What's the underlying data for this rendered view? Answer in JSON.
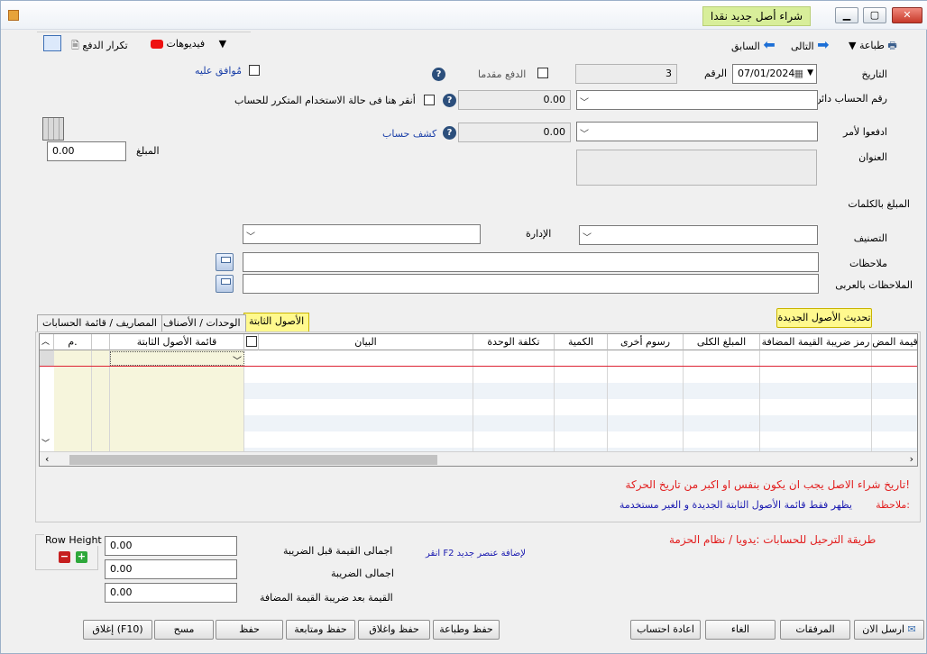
{
  "window": {
    "title": "شراء أصل جديد نقدا"
  },
  "toolbar": {
    "print": "طباعة",
    "next": "التالى",
    "previous": "السابق",
    "videos": "فيديوهات",
    "repeat_payment": "تكرار الدفع"
  },
  "header": {
    "date_label": "التاريخ",
    "date_value": "07/01/2024",
    "number_label": "الرقم",
    "number_value": "3",
    "prepaid_label": "الدفع مقدما",
    "approved_label": "مُوافق عليه",
    "credit_account_label": "رقم  الحساب دائن",
    "credit_amount": "0.00",
    "recurring_label": "أنقر هنا فى حالة الاستخدام المتكرر للحساب",
    "pay_to_label": "ادفعوا لأمر",
    "pay_to_amount": "0.00",
    "statement_link": "كشف حساب",
    "address_label": "العنوان",
    "amount_label": "المبلغ",
    "amount_value": "0.00",
    "amount_words_label": "المبلغ بالكلمات",
    "category_label": "التصنيف",
    "department_label": "الإدارة",
    "notes_label": "ملاحظات",
    "notes_ar_label": "الملاحظات بالعربى"
  },
  "update_assets_button": "تحديث الأصول الجديدة",
  "tabs": [
    {
      "label": "الأصول الثابتة",
      "active": true
    },
    {
      "label": "الوحدات / الأصناف",
      "active": false
    },
    {
      "label": "المصاريف / قائمة الحسابات",
      "active": false
    }
  ],
  "grid": {
    "columns": [
      "م.",
      "قائمة الأصول الثابتة",
      "",
      "البيان",
      "تكلفة الوحدة",
      "الكمية",
      "رسوم أخرى",
      "المبلغ الكلى",
      "رمز ضريبة القيمة المضافة",
      "قيمة المض"
    ]
  },
  "messages": {
    "warning": "تاريخ شراء الاصل يجب ان يكون بنفس او اكبر من تاريخ الحركة!",
    "note_label": "ملاحظة:",
    "note_text": "يظهر فقط قائمة الأصول الثابتة الجديدة و الغير مستخدمة"
  },
  "row_height": {
    "label": "Row Height"
  },
  "totals": {
    "before_tax_label": "اجمالى القيمة قبل الضريبة",
    "before_tax_value": "0.00",
    "tax_label": "اجمالى الضريبة",
    "tax_value": "0.00",
    "after_tax_label": "القيمة بعد ضريبة القيمة المضافة",
    "after_tax_value": "0.00"
  },
  "add_hint": "انقر F2 لإضافة عنصر جديد",
  "posting_method": "طريقة الترحيل للحسابات :يدويا / نظام الحزمة",
  "footer_buttons": {
    "send_now": "ارسل الان",
    "attachments": "المرفقات",
    "cancel": "الغاء",
    "recalc": "اعادة احتساب",
    "save_print": "حفظ وطباعة",
    "save_close": "حفظ واغلاق",
    "save_continue": "حفظ ومتابعة",
    "save": "حفظ",
    "clear": "مسح",
    "close": "إغلاق (F10)"
  },
  "colors": {
    "title_highlight": "#d8ee9a",
    "active_tab": "#fff98e",
    "warning_text": "#e21e1e",
    "note_text": "#1a1ab0"
  }
}
